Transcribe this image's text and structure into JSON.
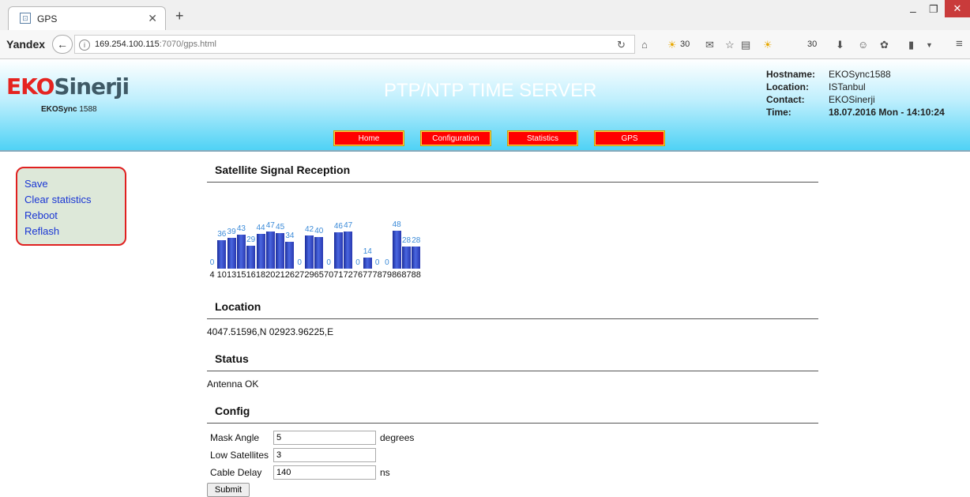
{
  "browser": {
    "tab_title": "GPS",
    "favicon": "⊡",
    "brand": "Yandex",
    "url_host": "169.254.100.115",
    "url_rest": ":7070/gps.html",
    "weather1": "30",
    "weather2": "30"
  },
  "header": {
    "logo_red": "EKO",
    "logo_grey": "Sinerji",
    "logo_sub_bold": "EKOSync",
    "logo_sub_num": "1588",
    "title": "PTP/NTP TIME SERVER",
    "nav": [
      "Home",
      "Configuration",
      "Statistics",
      "GPS"
    ],
    "info_labels": [
      "Hostname:",
      "Location:",
      "Contact:",
      "Time:"
    ],
    "hostname": "EKOSync1588",
    "location": "ISTanbul",
    "contact": "EKOSinerji",
    "time": "18.07.2016 Mon - 14:10:24"
  },
  "sidebar": {
    "items": [
      "Save",
      "Clear statistics",
      "Reboot",
      "Reflash"
    ]
  },
  "sections": {
    "signal": "Satellite Signal Reception",
    "location": "Location",
    "location_value": "4047.51596,N 02923.96225,E",
    "status": "Status",
    "status_value": "Antenna OK",
    "config": "Config"
  },
  "config_form": {
    "mask_angle_label": "Mask Angle",
    "mask_angle_value": "5",
    "mask_angle_unit": "degrees",
    "low_sat_label": "Low Satellites",
    "low_sat_value": "3",
    "cable_delay_label": "Cable Delay",
    "cable_delay_value": "140",
    "cable_delay_unit": "ns",
    "submit_label": "Submit"
  },
  "chart_data": {
    "type": "bar",
    "categories": [
      "4",
      "10",
      "13",
      "15",
      "16",
      "18",
      "20",
      "21",
      "26",
      "27",
      "29",
      "65",
      "70",
      "71",
      "72",
      "76",
      "77",
      "78",
      "79",
      "86",
      "87",
      "88"
    ],
    "values": [
      0,
      36,
      39,
      43,
      29,
      44,
      47,
      45,
      34,
      0,
      42,
      40,
      0,
      46,
      47,
      0,
      14,
      0,
      0,
      48,
      28,
      28
    ],
    "ylim": [
      0,
      50
    ],
    "colors": {
      "bar": "#2a3fc0",
      "value_label": "#3a8ad8"
    }
  }
}
